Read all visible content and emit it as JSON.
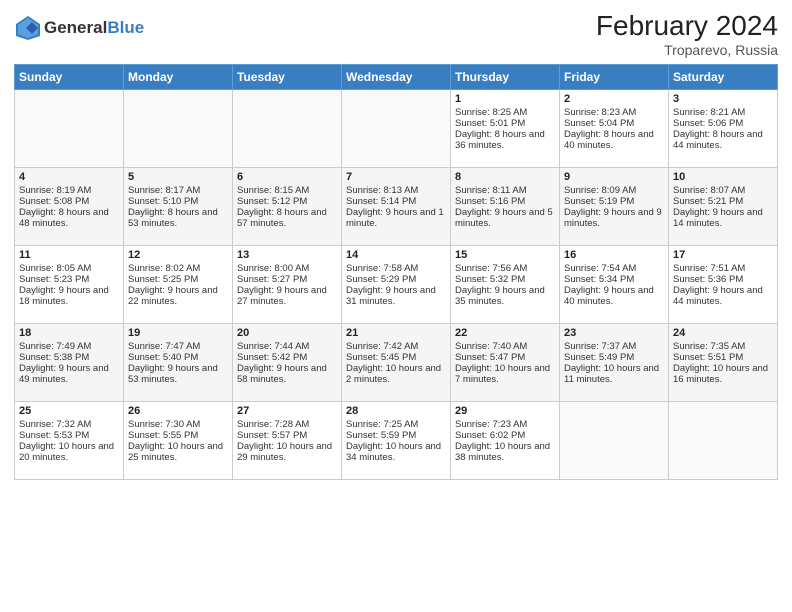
{
  "header": {
    "logo_line1": "General",
    "logo_line2": "Blue",
    "month_title": "February 2024",
    "location": "Troparevo, Russia"
  },
  "weekdays": [
    "Sunday",
    "Monday",
    "Tuesday",
    "Wednesday",
    "Thursday",
    "Friday",
    "Saturday"
  ],
  "weeks": [
    [
      {
        "day": "",
        "info": ""
      },
      {
        "day": "",
        "info": ""
      },
      {
        "day": "",
        "info": ""
      },
      {
        "day": "",
        "info": ""
      },
      {
        "day": "1",
        "info": "Sunrise: 8:25 AM\nSunset: 5:01 PM\nDaylight: 8 hours and 36 minutes."
      },
      {
        "day": "2",
        "info": "Sunrise: 8:23 AM\nSunset: 5:04 PM\nDaylight: 8 hours and 40 minutes."
      },
      {
        "day": "3",
        "info": "Sunrise: 8:21 AM\nSunset: 5:06 PM\nDaylight: 8 hours and 44 minutes."
      }
    ],
    [
      {
        "day": "4",
        "info": "Sunrise: 8:19 AM\nSunset: 5:08 PM\nDaylight: 8 hours and 48 minutes."
      },
      {
        "day": "5",
        "info": "Sunrise: 8:17 AM\nSunset: 5:10 PM\nDaylight: 8 hours and 53 minutes."
      },
      {
        "day": "6",
        "info": "Sunrise: 8:15 AM\nSunset: 5:12 PM\nDaylight: 8 hours and 57 minutes."
      },
      {
        "day": "7",
        "info": "Sunrise: 8:13 AM\nSunset: 5:14 PM\nDaylight: 9 hours and 1 minute."
      },
      {
        "day": "8",
        "info": "Sunrise: 8:11 AM\nSunset: 5:16 PM\nDaylight: 9 hours and 5 minutes."
      },
      {
        "day": "9",
        "info": "Sunrise: 8:09 AM\nSunset: 5:19 PM\nDaylight: 9 hours and 9 minutes."
      },
      {
        "day": "10",
        "info": "Sunrise: 8:07 AM\nSunset: 5:21 PM\nDaylight: 9 hours and 14 minutes."
      }
    ],
    [
      {
        "day": "11",
        "info": "Sunrise: 8:05 AM\nSunset: 5:23 PM\nDaylight: 9 hours and 18 minutes."
      },
      {
        "day": "12",
        "info": "Sunrise: 8:02 AM\nSunset: 5:25 PM\nDaylight: 9 hours and 22 minutes."
      },
      {
        "day": "13",
        "info": "Sunrise: 8:00 AM\nSunset: 5:27 PM\nDaylight: 9 hours and 27 minutes."
      },
      {
        "day": "14",
        "info": "Sunrise: 7:58 AM\nSunset: 5:29 PM\nDaylight: 9 hours and 31 minutes."
      },
      {
        "day": "15",
        "info": "Sunrise: 7:56 AM\nSunset: 5:32 PM\nDaylight: 9 hours and 35 minutes."
      },
      {
        "day": "16",
        "info": "Sunrise: 7:54 AM\nSunset: 5:34 PM\nDaylight: 9 hours and 40 minutes."
      },
      {
        "day": "17",
        "info": "Sunrise: 7:51 AM\nSunset: 5:36 PM\nDaylight: 9 hours and 44 minutes."
      }
    ],
    [
      {
        "day": "18",
        "info": "Sunrise: 7:49 AM\nSunset: 5:38 PM\nDaylight: 9 hours and 49 minutes."
      },
      {
        "day": "19",
        "info": "Sunrise: 7:47 AM\nSunset: 5:40 PM\nDaylight: 9 hours and 53 minutes."
      },
      {
        "day": "20",
        "info": "Sunrise: 7:44 AM\nSunset: 5:42 PM\nDaylight: 9 hours and 58 minutes."
      },
      {
        "day": "21",
        "info": "Sunrise: 7:42 AM\nSunset: 5:45 PM\nDaylight: 10 hours and 2 minutes."
      },
      {
        "day": "22",
        "info": "Sunrise: 7:40 AM\nSunset: 5:47 PM\nDaylight: 10 hours and 7 minutes."
      },
      {
        "day": "23",
        "info": "Sunrise: 7:37 AM\nSunset: 5:49 PM\nDaylight: 10 hours and 11 minutes."
      },
      {
        "day": "24",
        "info": "Sunrise: 7:35 AM\nSunset: 5:51 PM\nDaylight: 10 hours and 16 minutes."
      }
    ],
    [
      {
        "day": "25",
        "info": "Sunrise: 7:32 AM\nSunset: 5:53 PM\nDaylight: 10 hours and 20 minutes."
      },
      {
        "day": "26",
        "info": "Sunrise: 7:30 AM\nSunset: 5:55 PM\nDaylight: 10 hours and 25 minutes."
      },
      {
        "day": "27",
        "info": "Sunrise: 7:28 AM\nSunset: 5:57 PM\nDaylight: 10 hours and 29 minutes."
      },
      {
        "day": "28",
        "info": "Sunrise: 7:25 AM\nSunset: 5:59 PM\nDaylight: 10 hours and 34 minutes."
      },
      {
        "day": "29",
        "info": "Sunrise: 7:23 AM\nSunset: 6:02 PM\nDaylight: 10 hours and 38 minutes."
      },
      {
        "day": "",
        "info": ""
      },
      {
        "day": "",
        "info": ""
      }
    ]
  ]
}
